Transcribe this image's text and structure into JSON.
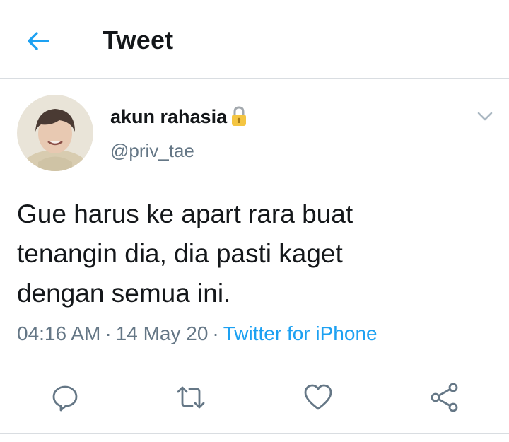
{
  "header": {
    "back_icon": "back-arrow-icon",
    "title": "Tweet"
  },
  "tweet": {
    "author": {
      "display_name": "akun rahasia",
      "badge_icon": "lock-icon",
      "handle": "@priv_tae",
      "avatar_icon": "profile-avatar"
    },
    "text": "Gue harus ke apart rara buat\ntenangin dia, dia pasti kaget\ndengan semua ini.",
    "time": "04:16 AM",
    "date": "14 May 20",
    "separator": "·",
    "source": "Twitter for iPhone"
  },
  "actions": [
    {
      "icon": "reply-icon"
    },
    {
      "icon": "retweet-icon"
    },
    {
      "icon": "like-icon"
    },
    {
      "icon": "share-icon"
    }
  ],
  "colors": {
    "accent": "#1da1f2",
    "text_primary": "#14171a",
    "text_secondary": "#657786",
    "divider": "#d9dde1",
    "lock_yellow": "#f4c542"
  }
}
